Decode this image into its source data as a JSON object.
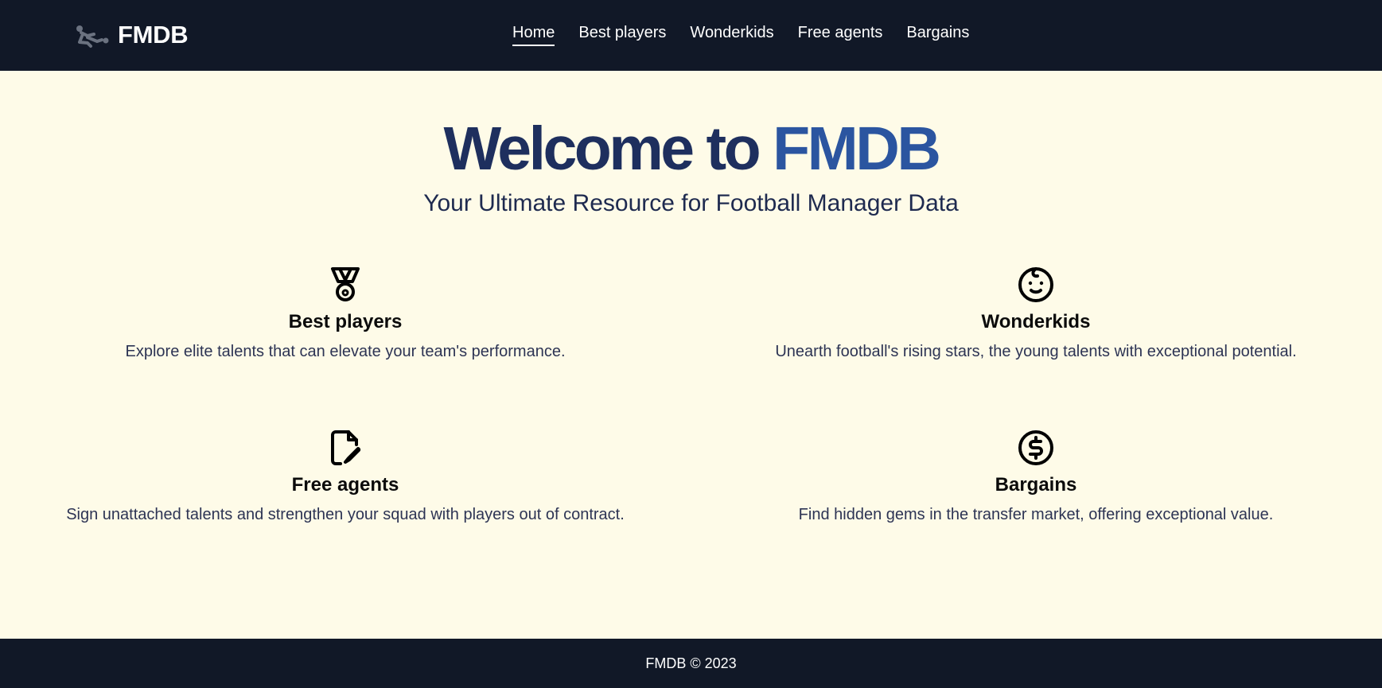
{
  "header": {
    "brand": "FMDB",
    "nav": [
      {
        "label": "Home",
        "active": true
      },
      {
        "label": "Best players",
        "active": false
      },
      {
        "label": "Wonderkids",
        "active": false
      },
      {
        "label": "Free agents",
        "active": false
      },
      {
        "label": "Bargains",
        "active": false
      }
    ]
  },
  "hero": {
    "title_prefix": "Welcome to",
    "title_accent": "FMDB",
    "subtitle": "Your Ultimate Resource for Football Manager Data"
  },
  "features": [
    {
      "icon": "medal-icon",
      "title": "Best players",
      "description": "Explore elite talents that can elevate your team's performance."
    },
    {
      "icon": "baby-face-icon",
      "title": "Wonderkids",
      "description": "Unearth football's rising stars, the young talents with exceptional potential."
    },
    {
      "icon": "document-edit-icon",
      "title": "Free agents",
      "description": "Sign unattached talents and strengthen your squad with players out of contract."
    },
    {
      "icon": "dollar-coin-icon",
      "title": "Bargains",
      "description": "Find hidden gems in the transfer market, offering exceptional value."
    }
  ],
  "footer": {
    "text": "FMDB © 2023"
  },
  "colors": {
    "header_bg": "#111827",
    "page_bg": "#fefbe8",
    "title_dark": "#1e2f5e",
    "title_accent": "#2b55a0"
  }
}
